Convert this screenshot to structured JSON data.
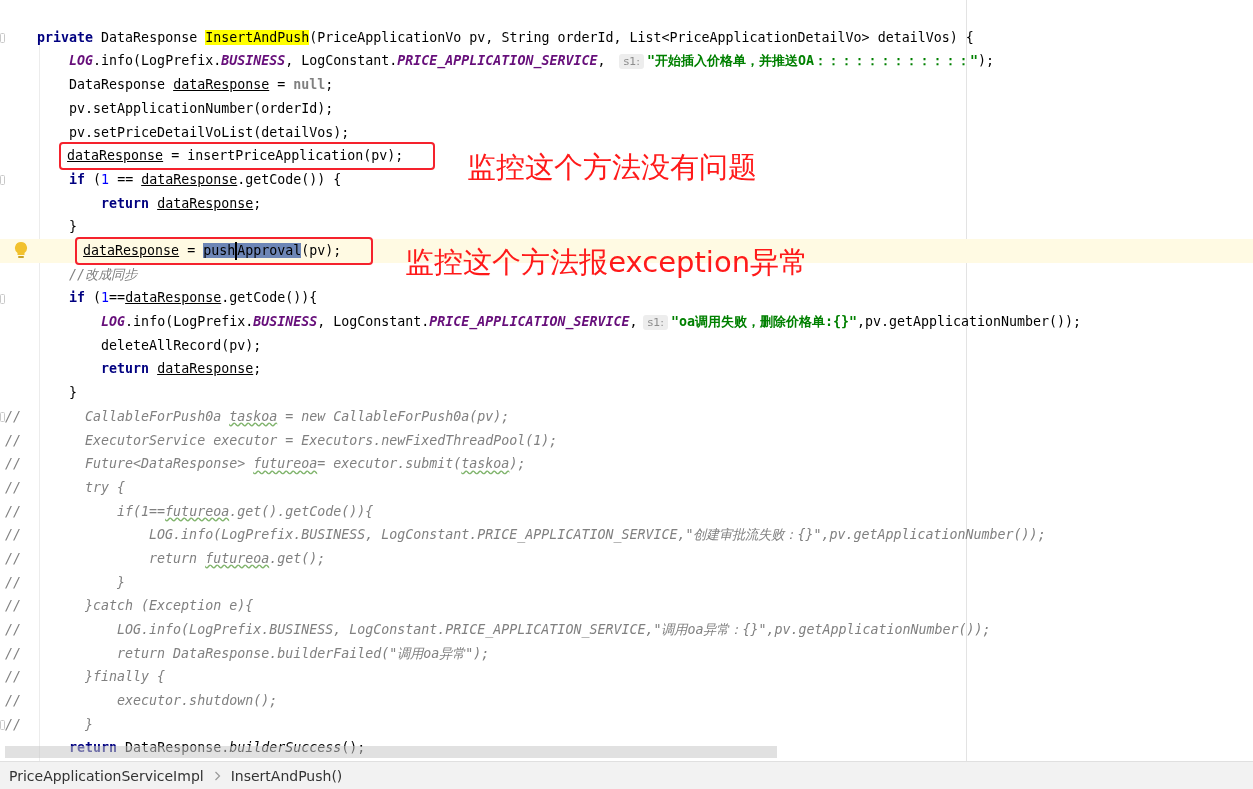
{
  "editor": {
    "lines": [
      {
        "fold": true,
        "tokens": [
          {
            "kind": "keyword",
            "text": "    private"
          },
          {
            "kind": "text",
            "text": " DataResponse "
          },
          {
            "kind": "search-hit",
            "text": "InsertAndPush"
          },
          {
            "kind": "text",
            "text": "(PriceApplicationVo pv, String orderId, List<PriceApplicationDetailVo> detailVos) {"
          }
        ]
      },
      {
        "tokens": [
          {
            "kind": "static",
            "text": "        LOG"
          },
          {
            "kind": "text",
            "text": ".info(LogPrefix."
          },
          {
            "kind": "static",
            "text": "BUSINESS"
          },
          {
            "kind": "text",
            "text": ", LogConstant."
          },
          {
            "kind": "static",
            "text": "PRICE_APPLICATION_SERVICE"
          },
          {
            "kind": "text",
            "text": ", "
          },
          {
            "kind": "hint",
            "text": "s1:"
          },
          {
            "kind": "string",
            "text": "\"开始插入价格单，并推送OA：：：：：：：：：：：：\""
          },
          {
            "kind": "text",
            "text": ");"
          }
        ]
      },
      {
        "tokens": [
          {
            "kind": "text",
            "text": "        DataResponse "
          },
          {
            "kind": "var",
            "text": "dataResponse"
          },
          {
            "kind": "text",
            "text": " = "
          },
          {
            "kind": "literal",
            "text": "null"
          },
          {
            "kind": "text",
            "text": ";"
          }
        ]
      },
      {
        "tokens": [
          {
            "kind": "text",
            "text": "        pv.setApplicationNumber(orderId);"
          }
        ]
      },
      {
        "tokens": [
          {
            "kind": "text",
            "text": "        pv.setPriceDetailVoList(detailVos);"
          }
        ]
      },
      {
        "annotation": "监控这个方法没有问题",
        "tokens": [
          {
            "kind": "var",
            "text": "        dataResponse"
          },
          {
            "kind": "text",
            "text": " = insertPriceApplication(pv);"
          }
        ]
      },
      {
        "fold": true,
        "tokens": [
          {
            "kind": "keyword",
            "text": "        if"
          },
          {
            "kind": "text",
            "text": " ("
          },
          {
            "kind": "number",
            "text": "1"
          },
          {
            "kind": "text",
            "text": " == "
          },
          {
            "kind": "var",
            "text": "dataResponse"
          },
          {
            "kind": "text",
            "text": ".getCode()) {"
          }
        ]
      },
      {
        "tokens": [
          {
            "kind": "keyword",
            "text": "            return "
          },
          {
            "kind": "var",
            "text": "dataResponse"
          },
          {
            "kind": "text",
            "text": ";"
          }
        ]
      },
      {
        "tokens": [
          {
            "kind": "text",
            "text": "        }"
          }
        ]
      },
      {
        "current": true,
        "annotation": "监控这个方法报exception异常",
        "tokens": [
          {
            "kind": "var",
            "text": "          dataResponse"
          },
          {
            "kind": "text",
            "text": " = "
          },
          {
            "kind": "selection",
            "text": "push"
          },
          {
            "kind": "caret"
          },
          {
            "kind": "selection",
            "text": "Approval"
          },
          {
            "kind": "text",
            "text": "(pv);"
          }
        ]
      },
      {
        "tokens": [
          {
            "kind": "comment",
            "text": "        //改成同步"
          }
        ]
      },
      {
        "fold": true,
        "tokens": [
          {
            "kind": "keyword",
            "text": "        if"
          },
          {
            "kind": "text",
            "text": " ("
          },
          {
            "kind": "number",
            "text": "1"
          },
          {
            "kind": "text",
            "text": "=="
          },
          {
            "kind": "var",
            "text": "dataResponse"
          },
          {
            "kind": "text",
            "text": ".getCode()){"
          }
        ]
      },
      {
        "tokens": [
          {
            "kind": "static",
            "text": "            LOG"
          },
          {
            "kind": "text",
            "text": ".info(LogPrefix."
          },
          {
            "kind": "static",
            "text": "BUSINESS"
          },
          {
            "kind": "text",
            "text": ", LogConstant."
          },
          {
            "kind": "static",
            "text": "PRICE_APPLICATION_SERVICE"
          },
          {
            "kind": "text",
            "text": ","
          },
          {
            "kind": "hint",
            "text": "s1:"
          },
          {
            "kind": "string",
            "text": "\"oa调用失败，删除价格单:{}\""
          },
          {
            "kind": "text",
            "text": ",pv.getApplicationNumber());"
          }
        ]
      },
      {
        "tokens": [
          {
            "kind": "text",
            "text": "            deleteAllRecord(pv);"
          }
        ]
      },
      {
        "tokens": [
          {
            "kind": "keyword",
            "text": "            return "
          },
          {
            "kind": "var",
            "text": "dataResponse"
          },
          {
            "kind": "text",
            "text": ";"
          }
        ]
      },
      {
        "tokens": [
          {
            "kind": "text",
            "text": "        }"
          }
        ]
      },
      {
        "fold": true,
        "tokens": [
          {
            "kind": "comment",
            "text": "//        CallableForPush0a "
          },
          {
            "kind": "typo",
            "text": "taskoa"
          },
          {
            "kind": "comment",
            "text": " = new CallableForPush0a(pv);"
          }
        ]
      },
      {
        "tokens": [
          {
            "kind": "comment",
            "text": "//        ExecutorService executor = Executors.newFixedThreadPool(1);"
          }
        ]
      },
      {
        "tokens": [
          {
            "kind": "comment",
            "text": "//        Future<DataResponse> "
          },
          {
            "kind": "typo",
            "text": "futureoa"
          },
          {
            "kind": "comment",
            "text": "= executor.submit("
          },
          {
            "kind": "typo",
            "text": "taskoa"
          },
          {
            "kind": "comment",
            "text": ");"
          }
        ]
      },
      {
        "tokens": [
          {
            "kind": "comment",
            "text": "//        try {"
          }
        ]
      },
      {
        "tokens": [
          {
            "kind": "comment",
            "text": "//            if(1=="
          },
          {
            "kind": "typo",
            "text": "futureoa"
          },
          {
            "kind": "comment",
            "text": ".get().getCode()){"
          }
        ]
      },
      {
        "tokens": [
          {
            "kind": "comment",
            "text": "//                LOG.info(LogPrefix.BUSINESS, LogConstant.PRICE_APPLICATION_SERVICE,\"创建审批流失败：{}\",pv.getApplicationNumber());"
          }
        ]
      },
      {
        "tokens": [
          {
            "kind": "comment",
            "text": "//                return "
          },
          {
            "kind": "typo",
            "text": "futureoa"
          },
          {
            "kind": "comment",
            "text": ".get();"
          }
        ]
      },
      {
        "tokens": [
          {
            "kind": "comment",
            "text": "//            }"
          }
        ]
      },
      {
        "tokens": [
          {
            "kind": "comment",
            "text": "//        }catch (Exception e){"
          }
        ]
      },
      {
        "tokens": [
          {
            "kind": "comment",
            "text": "//            LOG.info(LogPrefix.BUSINESS, LogConstant.PRICE_APPLICATION_SERVICE,\"调用oa异常：{}\",pv.getApplicationNumber());"
          }
        ]
      },
      {
        "tokens": [
          {
            "kind": "comment",
            "text": "//            return DataResponse.builderFailed(\"调用oa异常\");"
          }
        ]
      },
      {
        "tokens": [
          {
            "kind": "comment",
            "text": "//        }finally {"
          }
        ]
      },
      {
        "tokens": [
          {
            "kind": "comment",
            "text": "//            executor.shutdown();"
          }
        ]
      },
      {
        "fold": true,
        "tokens": [
          {
            "kind": "comment",
            "text": "//        }"
          }
        ]
      },
      {
        "tokens": [
          {
            "kind": "keyword",
            "text": "        return"
          },
          {
            "kind": "text",
            "text": " DataResponse."
          },
          {
            "kind": "italic",
            "text": "builderSuccess"
          },
          {
            "kind": "text",
            "text": "();"
          }
        ]
      }
    ]
  },
  "breadcrumbs": [
    "PriceApplicationServiceImpl",
    "InsertAndPush()"
  ]
}
